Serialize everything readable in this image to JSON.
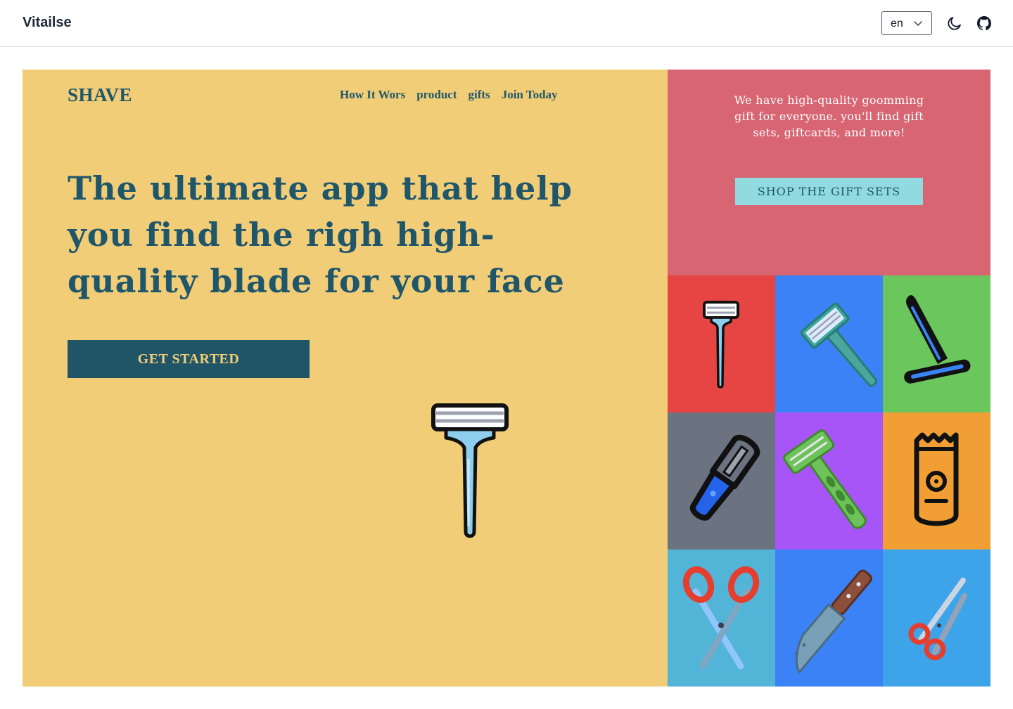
{
  "app": {
    "title": "Vitailse"
  },
  "header": {
    "language": "en",
    "icons": [
      "moon-icon",
      "github-icon"
    ]
  },
  "hero": {
    "logo": "SHAVE",
    "nav": [
      "How It Wors",
      "product",
      "gifts",
      "Join Today"
    ],
    "headline": "The ultimate app that help you find the righ high-quality blade for your face",
    "cta": "GET STARTED",
    "background": "#f1cd78",
    "text_color": "#20566a"
  },
  "gift": {
    "text": "We have high-quality goomming gift for everyone. you'll find gift sets, giftcards, and more!",
    "button": "SHOP THE GIFT SETS",
    "background": "#d76572",
    "button_color": "#91dbe0"
  },
  "tiles": [
    {
      "icon": "razor-icon",
      "color": "#e74444"
    },
    {
      "icon": "safety-razor-icon",
      "color": "#3b82f6"
    },
    {
      "icon": "straight-razor-icon",
      "color": "#6bc65e"
    },
    {
      "icon": "peeler-razor-icon",
      "color": "#6b7280"
    },
    {
      "icon": "disposable-razor-icon",
      "color": "#a855f7"
    },
    {
      "icon": "electric-shaver-icon",
      "color": "#f19f35"
    },
    {
      "icon": "scissors-icon",
      "color": "#52b5d7"
    },
    {
      "icon": "knife-icon",
      "color": "#3b82f6"
    },
    {
      "icon": "small-scissors-icon",
      "color": "#3ea4ea"
    }
  ]
}
